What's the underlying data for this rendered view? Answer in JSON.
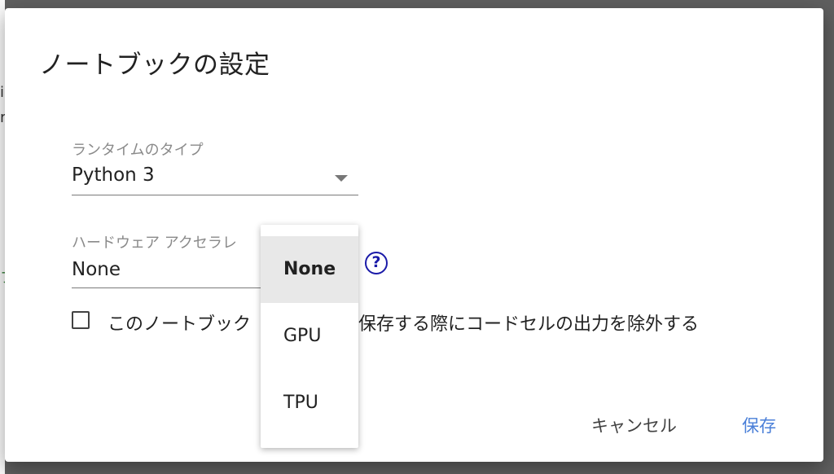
{
  "background": {
    "fragments": [
      "i",
      "r",
      "フ"
    ]
  },
  "dialog": {
    "title": "ノートブックの設定",
    "runtime": {
      "label": "ランタイムのタイプ",
      "value": "Python 3"
    },
    "accelerator": {
      "label": "ハードウェア アクセラレ",
      "value": "None",
      "options": [
        "None",
        "GPU",
        "TPU"
      ],
      "selected": "None"
    },
    "checkbox": {
      "label": "このノートブック　　　　　を保存する際にコードセルの出力を除外する",
      "checked": false
    },
    "actions": {
      "cancel": "キャンセル",
      "save": "保存"
    },
    "help_icon_glyph": "?"
  },
  "colors": {
    "accent": "#4a7fd8",
    "help_icon": "#1a1aa8",
    "overlay": "#5f5f5f"
  }
}
